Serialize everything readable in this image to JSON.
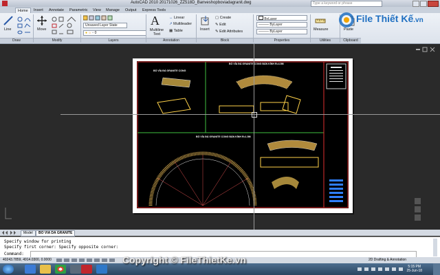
{
  "title_bar": {
    "title": "AutoCAD 2010     20171026_ZZ518D_Banveshopboviadagranit.dwg",
    "search_placeholder": "Type a keyword or phrase"
  },
  "tabs": [
    "Home",
    "Insert",
    "Annotate",
    "Parametric",
    "View",
    "Manage",
    "Output",
    "Express Tools"
  ],
  "ribbon": {
    "draw": {
      "line": "Line",
      "label": "Draw"
    },
    "modify": {
      "move": "Move",
      "label": "Modify"
    },
    "layers": {
      "state": "Unsaved Layer State",
      "label": "Layers",
      "current": "0"
    },
    "annotation": {
      "mtext": "Multiline Text",
      "linear": "Linear",
      "mleader": "Multileader",
      "table": "Table",
      "label": "Annotation"
    },
    "block": {
      "insert": "Insert",
      "create": "Create",
      "edit": "Edit",
      "edit_attr": "Edit Attributes",
      "label": "Block"
    },
    "properties": {
      "color": "ByLayer",
      "linetype": "ByLayer",
      "lineweight": "ByLayer",
      "label": "Properties"
    },
    "utilities": {
      "measure": "Measure",
      "label": "Utilities"
    },
    "clipboard": {
      "paste": "Paste",
      "label": "Clipboard"
    }
  },
  "logo": {
    "text1": "File",
    "text2": "Thiết Kế",
    "text3": ".vn"
  },
  "drawing": {
    "title1": "BỐ VỈA ĐÁ GRANITE CONG",
    "title2": "BỐ VỈA ĐÁ GRANITE CONG BÁN KÍNH R=4.5M",
    "title3": "BỐ VỈA ĐÁ GRANITE CONG BÁN KÍNH R=1.5M"
  },
  "layout_tabs": [
    "Model",
    "BO VIA DA GRANITE"
  ],
  "command": {
    "line1": "Specify window for printing",
    "line2": "Specify first corner: Specify opposite corner:",
    "prompt": "Command:"
  },
  "status": {
    "coords": "40243.7859, 4914.0300, 0.0000",
    "workspace": "2D Drafting & Annotation"
  },
  "taskbar": {
    "time": "5:15 PM",
    "date": "25-Jun-18"
  },
  "watermark": "Copyright © FileThietKe.vn"
}
